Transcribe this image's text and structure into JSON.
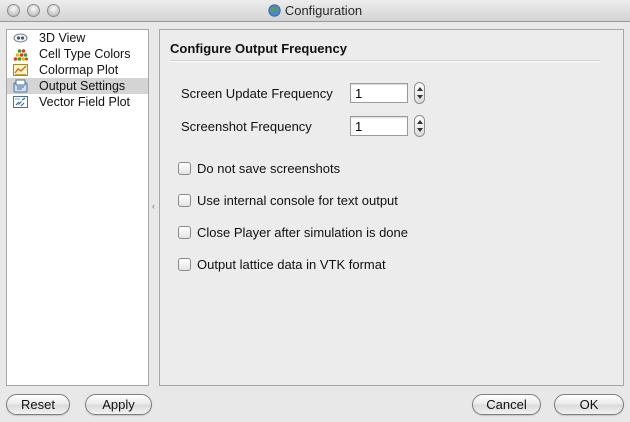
{
  "window": {
    "title": "Configuration"
  },
  "sidebar": {
    "items": [
      {
        "label": "3D View",
        "icon": "eye-icon",
        "selected": false
      },
      {
        "label": "Cell Type Colors",
        "icon": "color-dots-icon",
        "selected": false
      },
      {
        "label": "Colormap Plot",
        "icon": "colormap-icon",
        "selected": false
      },
      {
        "label": "Output Settings",
        "icon": "output-settings-icon",
        "selected": true
      },
      {
        "label": "Vector Field Plot",
        "icon": "vector-field-icon",
        "selected": false
      }
    ]
  },
  "panel": {
    "title": "Configure Output Frequency",
    "screen_update": {
      "label": "Screen Update Frequency",
      "value": "1"
    },
    "screenshot": {
      "label": "Screenshot Frequency",
      "value": "1"
    },
    "checkboxes": [
      {
        "label": "Do not save screenshots",
        "checked": false
      },
      {
        "label": "Use internal console for text output",
        "checked": false
      },
      {
        "label": "Close Player after simulation is done",
        "checked": false
      },
      {
        "label": "Output lattice data in VTK format",
        "checked": false
      }
    ]
  },
  "buttons": {
    "reset": "Reset",
    "apply": "Apply",
    "cancel": "Cancel",
    "ok": "OK"
  },
  "colors": {
    "selection": "#d4d4d4",
    "window_bg": "#e8e8e8"
  }
}
